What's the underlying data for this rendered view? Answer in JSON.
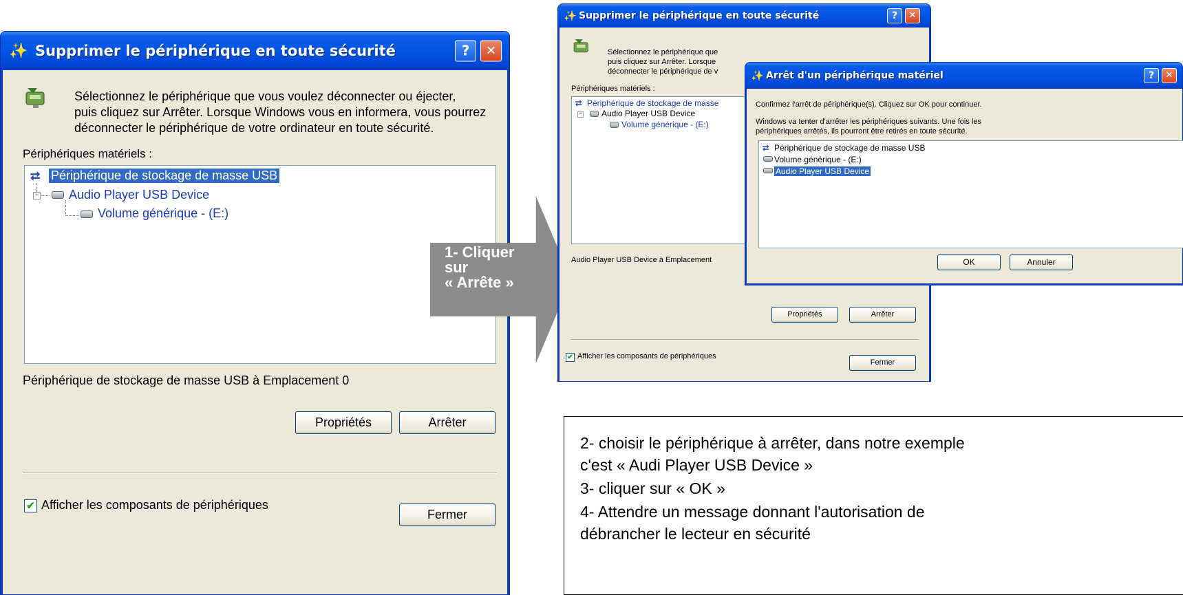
{
  "big_window": {
    "title": "Supprimer le périphérique en toute sécurité",
    "help": "?",
    "close": "✕",
    "intro_line1": "Sélectionnez le périphérique que vous voulez déconnecter ou éjecter,",
    "intro_line2": "puis cliquez sur Arrêter. Lorsque Windows vous en informera, vous pourrez",
    "intro_line3": "déconnecter le périphérique de votre ordinateur en toute sécurité.",
    "hardware_label": "Périphériques matériels :",
    "tree": [
      "Périphérique de stockage de masse USB",
      "Audio Player USB Device",
      "Volume générique - (E:)"
    ],
    "status": "Périphérique de stockage de masse USB à Emplacement 0",
    "properties": "Propriétés",
    "stop": "Arrêter",
    "show_components": "Afficher les composants de périphériques",
    "close_button": "Fermer"
  },
  "small_window": {
    "title": "Supprimer le périphérique en toute sécurité",
    "help": "?",
    "close": "✕",
    "intro_line1": "Sélectionnez le périphérique que",
    "intro_line2": "puis cliquez sur Arrêter. Lorsque",
    "intro_line3": "déconnecter le périphérique de v",
    "hardware_label": "Périphériques matériels :",
    "tree": [
      "Périphérique de stockage de masse",
      "Audio Player USB Device",
      "Volume générique - (E:)"
    ],
    "status": "Audio Player USB Device à Emplacement",
    "properties": "Propriétés",
    "stop": "Arrêter",
    "show_components": "Afficher les composants de périphériques",
    "close_button": "Fermer"
  },
  "stop_dialog": {
    "title": "Arrêt d'un périphérique matériel",
    "help": "?",
    "close": "✕",
    "confirm": "Confirmez l'arrêt de périphérique(s). Cliquez sur OK pour continuer.",
    "info_line1": "Windows va tenter d'arrêter les périphériques suivants. Une fois les",
    "info_line2": "périphériques arrêtés, ils pourront être retirés en toute sécurité.",
    "items": [
      "Périphérique de stockage de masse USB",
      "Volume générique - (E:)",
      "Audio Player USB Device"
    ],
    "ok": "OK",
    "cancel": "Annuler"
  },
  "arrow_label": "1- Cliquer\nsur\n« Arrête »",
  "instructions": [
    "2-  choisir  le périphérique à arrêter, dans notre exemple",
    "c'est «  Audi Player USB Device »",
    "3-  cliquer sur « OK »",
    "4- Attendre un message donnant l'autorisation de",
    "débrancher le lecteur en sécurité"
  ],
  "colors": {
    "title_bar": "#0055e5",
    "selection": "#316ac5",
    "dialog_bg": "#ece9d8",
    "arrow": "#8c8c8c"
  }
}
